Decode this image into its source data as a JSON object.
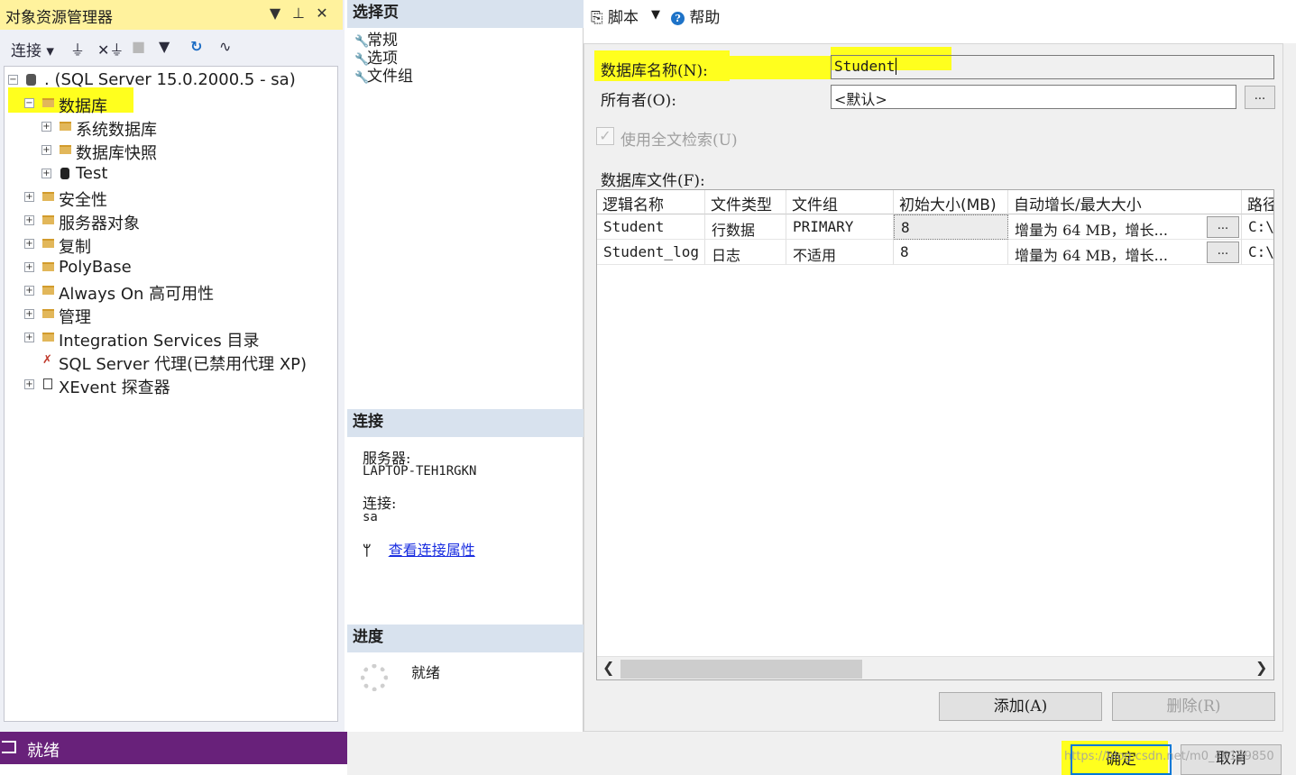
{
  "object_explorer": {
    "title": "对象资源管理器",
    "title_buttons": {
      "dropdown": "▼",
      "pin": "⊥",
      "close": "✕"
    },
    "toolbar": {
      "connect_label": "连接"
    },
    "tree": {
      "server": ". (SQL Server 15.0.2000.5 - sa)",
      "databases": "数据库",
      "system_databases": "系统数据库",
      "snapshots": "数据库快照",
      "test_db": "Test",
      "security": "安全性",
      "server_objects": "服务器对象",
      "replication": "复制",
      "polybase": "PolyBase",
      "always_on": "Always On 高可用性",
      "management": "管理",
      "integration_services": "Integration Services 目录",
      "agent": "SQL Server 代理(已禁用代理 XP)",
      "xevent": "XEvent 探查器"
    }
  },
  "status_bar": {
    "text": "就绪"
  },
  "dialog": {
    "select_page": {
      "header": "选择页",
      "pages": [
        "常规",
        "选项",
        "文件组"
      ]
    },
    "connection": {
      "header": "连接",
      "server_label": "服务器:",
      "server_value": "LAPTOP-TEH1RGKN",
      "connection_label": "连接:",
      "connection_value": "sa",
      "view_props_link": "查看连接属性"
    },
    "progress": {
      "header": "进度",
      "status": "就绪"
    },
    "toolbar": {
      "script": "脚本",
      "help": "帮助"
    },
    "general": {
      "db_name_label": "数据库名称(N):",
      "db_name_value": "Student",
      "owner_label": "所有者(O):",
      "owner_value": "<默认>",
      "owner_browse": "...",
      "fulltext_label": "使用全文检索(U)",
      "files_label": "数据库文件(F):"
    },
    "files_grid": {
      "columns": [
        "逻辑名称",
        "文件类型",
        "文件组",
        "初始大小(MB)",
        "自动增长/最大大小",
        "路径"
      ],
      "rows": [
        {
          "name": "Student",
          "type": "行数据",
          "filegroup": "PRIMARY",
          "size": "8",
          "growth": "增量为 64 MB，增长...",
          "btn": "...",
          "path": "C:\\"
        },
        {
          "name": "Student_log",
          "type": "日志",
          "filegroup": "不适用",
          "size": "8",
          "growth": "增量为 64 MB，增长...",
          "btn": "...",
          "path": "C:\\"
        }
      ]
    },
    "buttons": {
      "add": "添加(A)",
      "remove": "删除(R)",
      "ok": "确定",
      "cancel": "取消"
    },
    "watermark": "https://blog.csdn.net/m0_46159850"
  }
}
